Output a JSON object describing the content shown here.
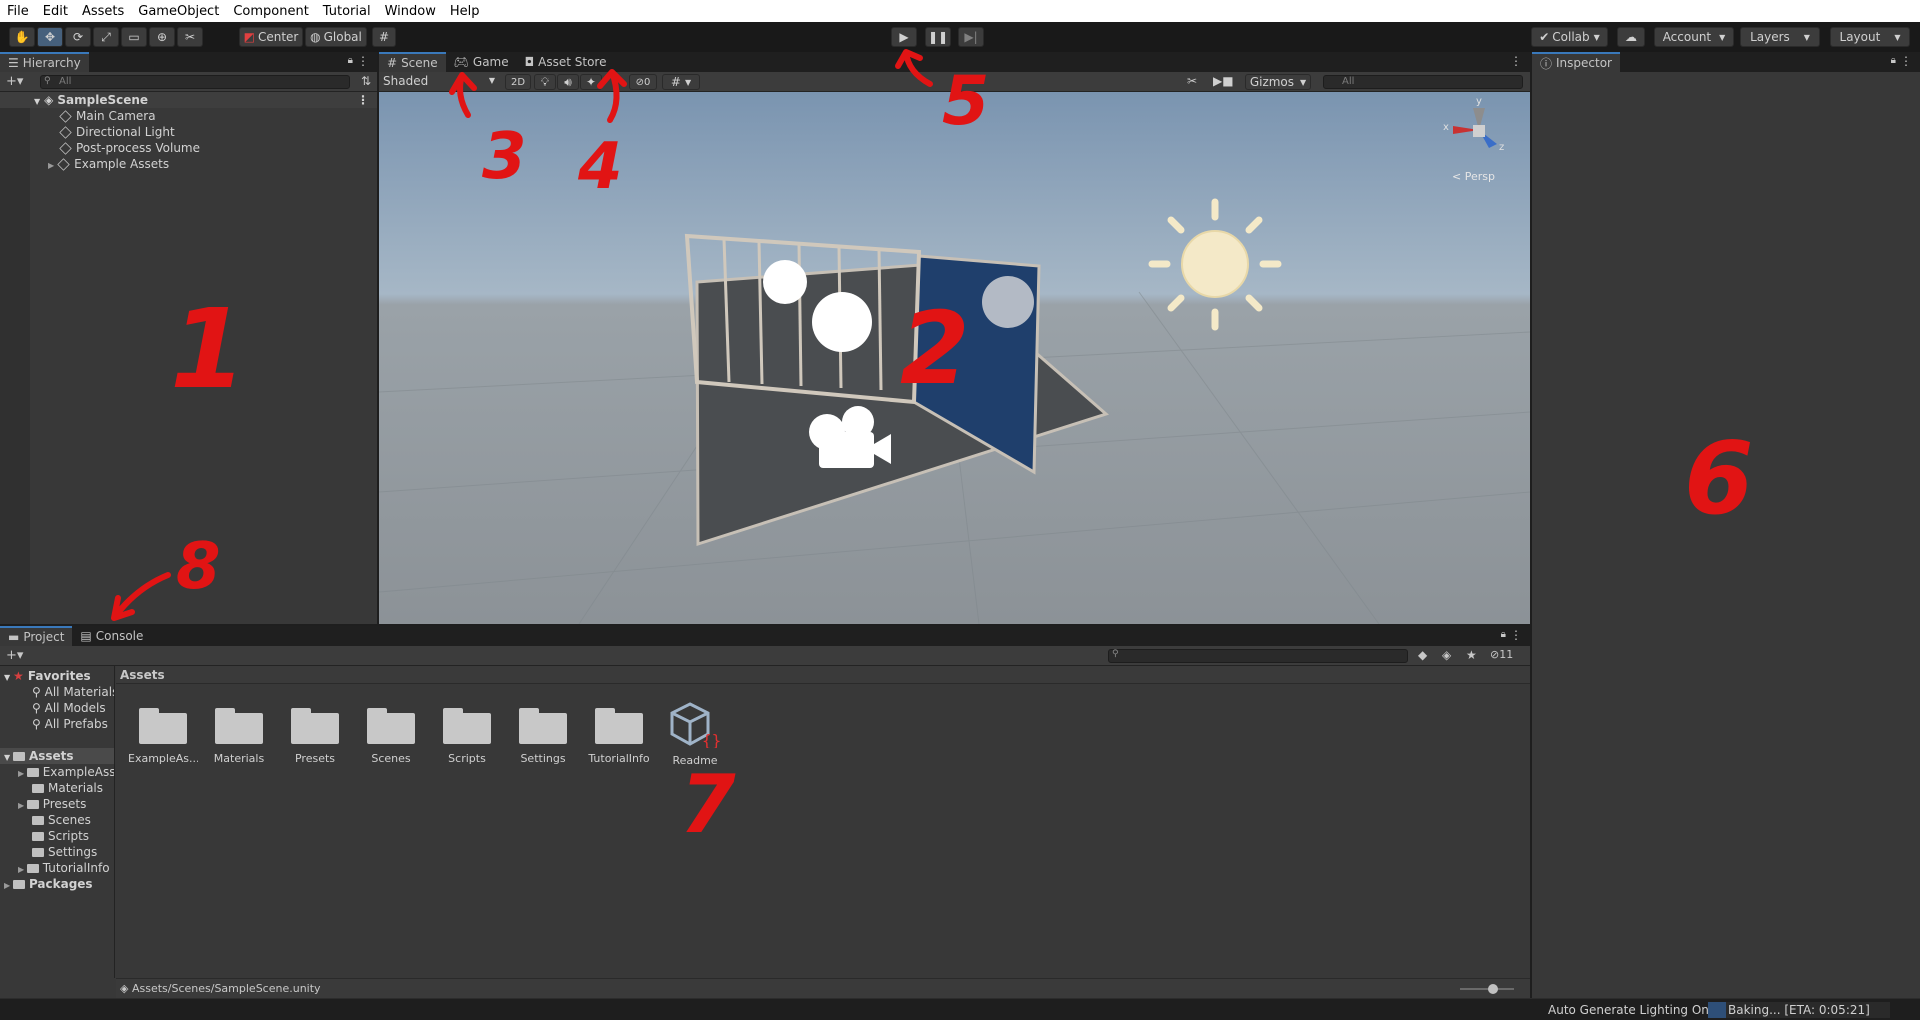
{
  "menu": [
    "File",
    "Edit",
    "Assets",
    "GameObject",
    "Component",
    "Tutorial",
    "Window",
    "Help"
  ],
  "toolbar": {
    "pivot_label": "Center",
    "space_label": "Global",
    "collab_label": "Collab",
    "account_label": "Account",
    "layers_label": "Layers",
    "layout_label": "Layout"
  },
  "hierarchy": {
    "tab": "Hierarchy",
    "search_placeholder": "All",
    "scene": "SampleScene",
    "items": [
      "Main Camera",
      "Directional Light",
      "Post-process Volume",
      "Example Assets"
    ]
  },
  "scene_view": {
    "tabs": [
      "Scene",
      "Game",
      "Asset Store"
    ],
    "shading": "Shaded",
    "mode_2d": "2D",
    "hidden_count": "0",
    "gizmos": "Gizmos",
    "search_placeholder": "All",
    "persp": "Persp",
    "axis_y": "y",
    "axis_x": "x",
    "axis_z": "z"
  },
  "inspector": {
    "tab": "Inspector"
  },
  "project": {
    "tabs": [
      "Project",
      "Console"
    ],
    "hidden_count": "11",
    "breadcrumb": "Assets",
    "favorites_label": "Favorites",
    "favorites": [
      "All Materials",
      "All Models",
      "All Prefabs"
    ],
    "assets_label": "Assets",
    "tree": [
      "ExampleAssets",
      "Materials",
      "Presets",
      "Scenes",
      "Scripts",
      "Settings",
      "TutorialInfo"
    ],
    "packages_label": "Packages",
    "grid": [
      "ExampleAs...",
      "Materials",
      "Presets",
      "Scenes",
      "Scripts",
      "Settings",
      "TutorialInfo",
      "Readme"
    ],
    "path": "Assets/Scenes/SampleScene.unity"
  },
  "status": {
    "lighting": "Auto Generate Lighting On",
    "baking": "Baking... [ETA: 0:05:21]"
  },
  "annotations": [
    "1",
    "2",
    "3",
    "4",
    "5",
    "6",
    "7",
    "8"
  ],
  "colors": {
    "accent": "#3a79bb",
    "annotation": "#e11414",
    "menubar": "#ffffff",
    "panel": "#383838"
  }
}
